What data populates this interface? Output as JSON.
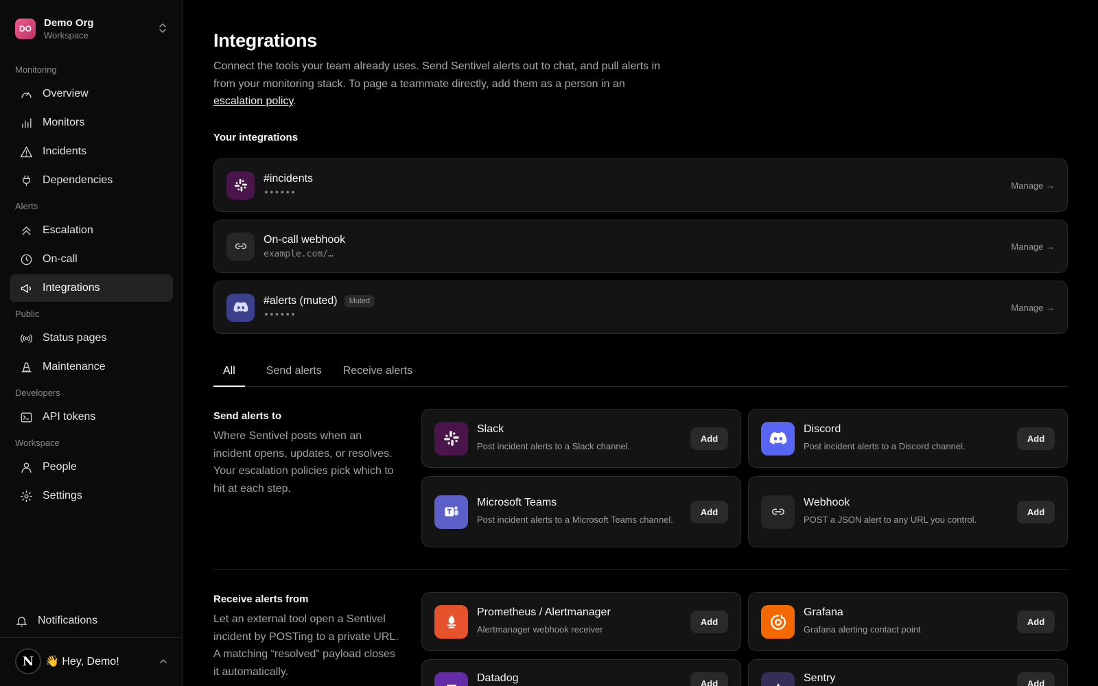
{
  "org": {
    "initials": "DO",
    "name": "Demo Org",
    "sub": "Workspace"
  },
  "nav": {
    "monitoring_label": "Monitoring",
    "overview": "Overview",
    "monitors": "Monitors",
    "incidents": "Incidents",
    "dependencies": "Dependencies",
    "alerts_label": "Alerts",
    "escalation": "Escalation",
    "oncall": "On-call",
    "integrations": "Integrations",
    "public_label": "Public",
    "status_pages": "Status pages",
    "maintenance": "Maintenance",
    "developers_label": "Developers",
    "api_tokens": "API tokens",
    "workspace_label": "Workspace",
    "people": "People",
    "settings": "Settings"
  },
  "footer": {
    "notifications": "Notifications",
    "avatar_letter": "N",
    "greeting": "👋 Hey, Demo!"
  },
  "page": {
    "title": "Integrations",
    "desc_pre": "Connect the tools your team already uses. Send Sentivel alerts out to chat, and pull alerts in from your monitoring stack. To page a teammate directly, add them as a person in an ",
    "desc_link": "escalation policy",
    "desc_post": ".",
    "your_integrations": "Your integrations"
  },
  "your_integrations": [
    {
      "name": "#incidents",
      "sub": "••••••",
      "badge": "",
      "manage": "Manage →",
      "icon": "slack-icon"
    },
    {
      "name": "On-call webhook",
      "sub": "example.com/…",
      "badge": "",
      "manage": "Manage →",
      "icon": "link-icon"
    },
    {
      "name": "#alerts (muted)",
      "sub": "••••••",
      "badge": "Muted",
      "manage": "Manage →",
      "icon": "discord-icon"
    }
  ],
  "tabs": {
    "all": "All",
    "send": "Send alerts",
    "receive": "Receive alerts"
  },
  "send_group": {
    "title": "Send alerts to",
    "desc": "Where Sentivel posts when an incident opens, updates, or resolves. Your escalation policies pick which to hit at each step.",
    "cards": [
      {
        "name": "Slack",
        "desc": "Post incident alerts to a Slack channel.",
        "add": "Add"
      },
      {
        "name": "Discord",
        "desc": "Post incident alerts to a Discord channel.",
        "add": "Add"
      },
      {
        "name": "Microsoft Teams",
        "desc": "Post incident alerts to a Microsoft Teams channel.",
        "add": "Add"
      },
      {
        "name": "Webhook",
        "desc": "POST a JSON alert to any URL you control.",
        "add": "Add"
      }
    ]
  },
  "receive_group": {
    "title": "Receive alerts from",
    "desc": "Let an external tool open a Sentivel incident by POSTing to a private URL. A matching “resolved” payload closes it automatically.",
    "cards": [
      {
        "name": "Prometheus / Alertmanager",
        "desc": "Alertmanager webhook receiver",
        "add": "Add"
      },
      {
        "name": "Grafana",
        "desc": "Grafana alerting contact point",
        "add": "Add"
      },
      {
        "name": "Datadog",
        "desc": "",
        "add": "Add"
      },
      {
        "name": "Sentry",
        "desc": "",
        "add": "Add"
      }
    ]
  },
  "colors": {
    "slack_bg": "#4a154b",
    "discord_bg": "#5865f2",
    "discord_muted_bg": "#3b3f8c",
    "teams_bg": "#5b5fc7",
    "webhook_bg": "#262626",
    "prometheus_bg": "#e6522c",
    "grafana_bg": "#f46800",
    "datadog_bg": "#632ca6",
    "sentry_bg": "#362d59"
  }
}
